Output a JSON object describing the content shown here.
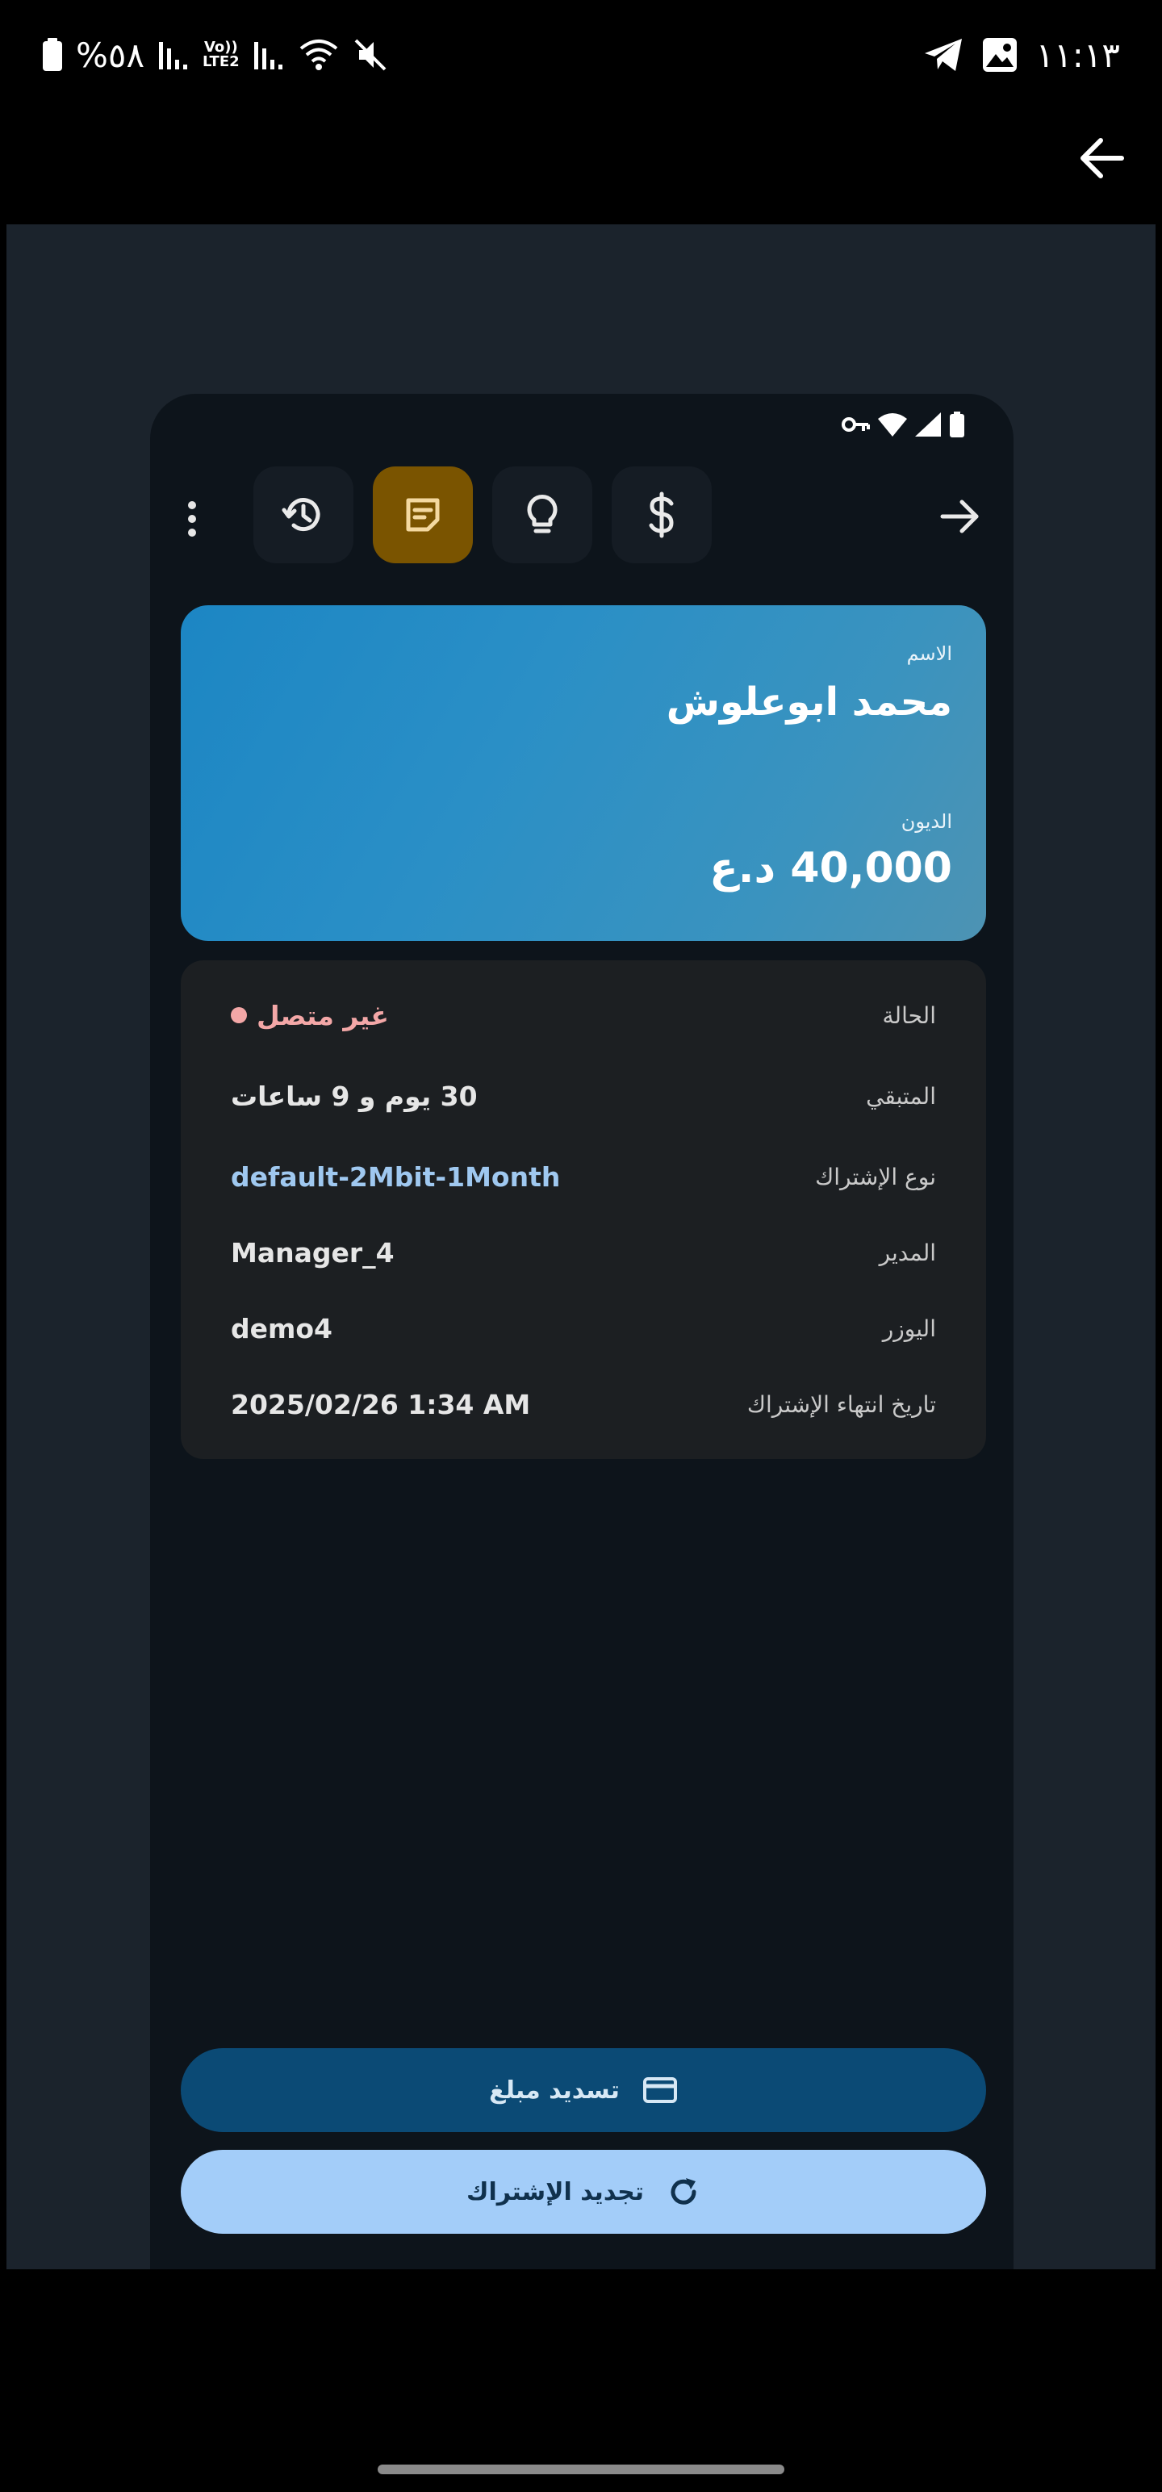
{
  "system_status": {
    "battery": "%٥٨",
    "volte": "Vo))",
    "lte": "LTE2",
    "time": "١١:١٣"
  },
  "viewer": {
    "back_icon": "arrow-left-icon"
  },
  "app": {
    "tabs": [
      {
        "icon": "history-icon",
        "active": false
      },
      {
        "icon": "notes-icon",
        "active": true
      },
      {
        "icon": "lightbulb-icon",
        "active": false
      },
      {
        "icon": "dollar-icon",
        "active": false
      }
    ],
    "card": {
      "name_label": "الاسم",
      "name": "محمد ابوعلوش",
      "debt_label": "الديون",
      "debt": "40,000 د.ع"
    },
    "details": {
      "status_label": "الحالة",
      "status_value": "غير متصل",
      "remaining_label": "المتبقي",
      "remaining_value": "30 يوم و 9 ساعات",
      "plan_label": "نوع الإشتراك",
      "plan_value": "default-2Mbit-1Month",
      "manager_label": "المدير",
      "manager_value": "Manager_4",
      "user_label": "اليوزر",
      "user_value": "demo4",
      "expiry_label": "تاريخ انتهاء الإشتراك",
      "expiry_value": "2025/02/26 1:34 AM"
    },
    "buttons": {
      "pay_label": "تسديد مبلغ",
      "renew_label": "تجديد الإشتراك"
    },
    "colors": {
      "active_tab": "#7a5400",
      "offline": "#f3a7a7",
      "plan_link": "#9fc8f0",
      "pay_button": "#0b4a75",
      "renew_button": "#a3cdf9"
    }
  }
}
